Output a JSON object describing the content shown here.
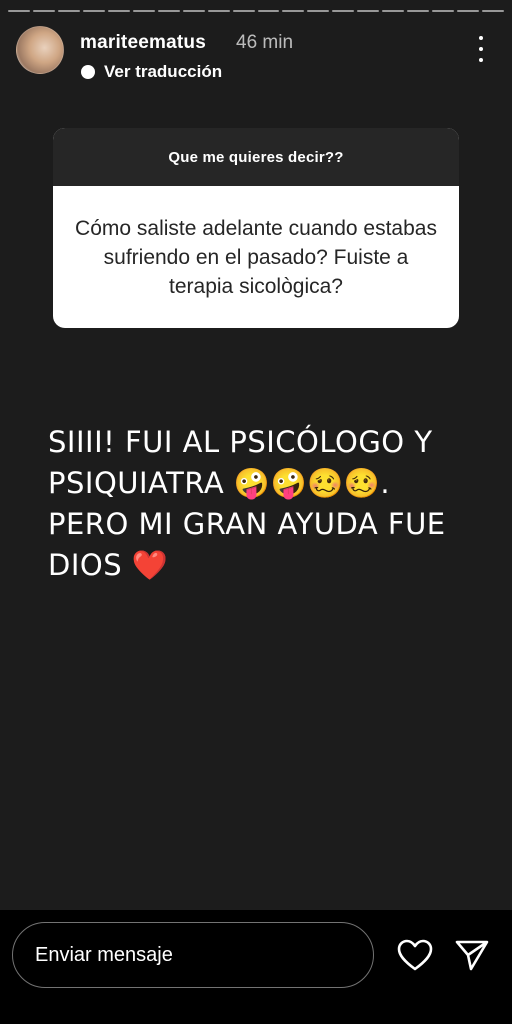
{
  "story": {
    "username": "mariteematus",
    "time": "46 min",
    "translate_label": "Ver traducción",
    "progress_segments": 20
  },
  "question": {
    "prompt": "Que me quieres decir??",
    "text": "Cómo saliste adelante cuando estabas sufriendo en el pasado? Fuiste a terapia sicològica?"
  },
  "answer": {
    "text": "SIIII! FUI AL PSICÓLOGO Y PSIQUIATRA 🤪🤪🥴🥴. PERO MI GRAN AYUDA FUE DIOS ❤️"
  },
  "footer": {
    "message_placeholder": "Enviar mensaje"
  },
  "icons": {
    "more": "more-vertical-icon",
    "like": "heart-icon",
    "send": "send-icon",
    "translate": "translate-icon"
  }
}
